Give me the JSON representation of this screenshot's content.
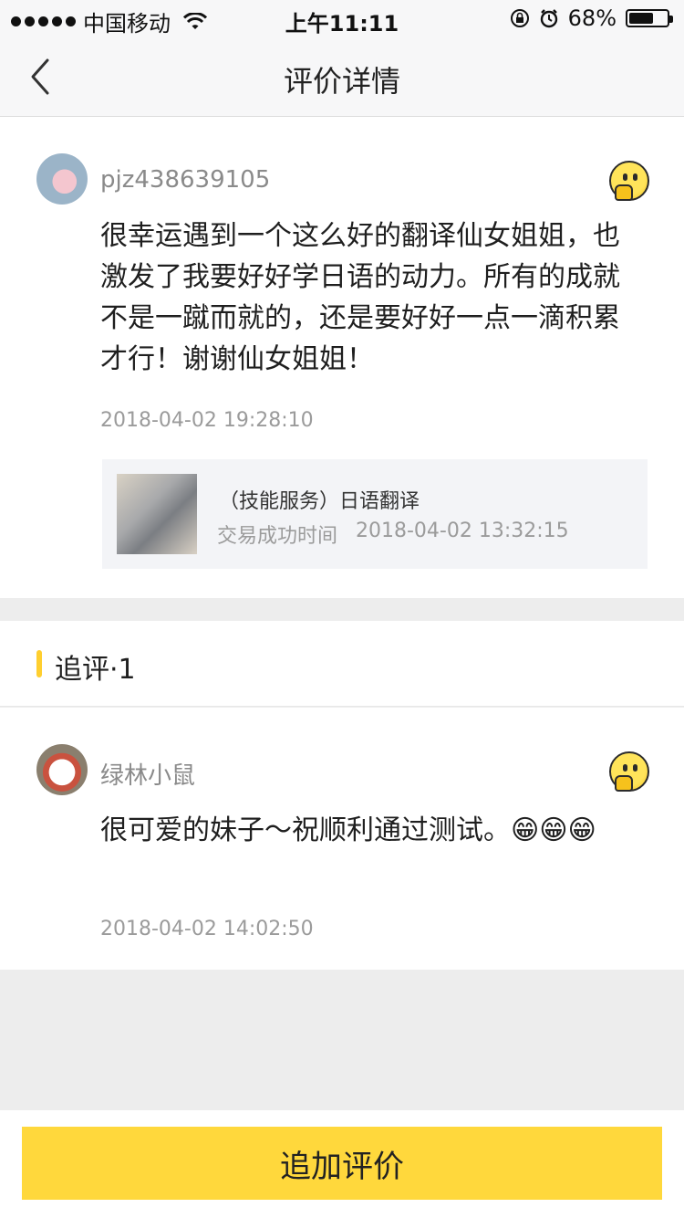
{
  "status_bar": {
    "carrier": "中国移动",
    "time": "上午11:11",
    "battery_percent": "68%",
    "battery_level": 0.68
  },
  "nav": {
    "title": "评价详情"
  },
  "review": {
    "username": "pjz438639105",
    "text": "很幸运遇到一个这么好的翻译仙女姐姐，也激发了我要好好学日语的动力。所有的成就不是一蹴而就的，还是要好好一点一滴积累才行！谢谢仙女姐姐！",
    "timestamp": "2018-04-02 19:28:10",
    "order": {
      "title": "（技能服务）日语翻译",
      "time_label": "交易成功时间",
      "time": "2018-04-02 13:32:15"
    }
  },
  "followup": {
    "title": "追评·1",
    "username": "绿林小鼠",
    "text": "很可爱的妹子～祝顺利通过测试。😁😁😁",
    "timestamp": "2018-04-02 14:02:50"
  },
  "cta": {
    "label": "追加评价"
  },
  "colors": {
    "accent": "#ffd83c",
    "text_secondary": "#9b9b9b"
  }
}
